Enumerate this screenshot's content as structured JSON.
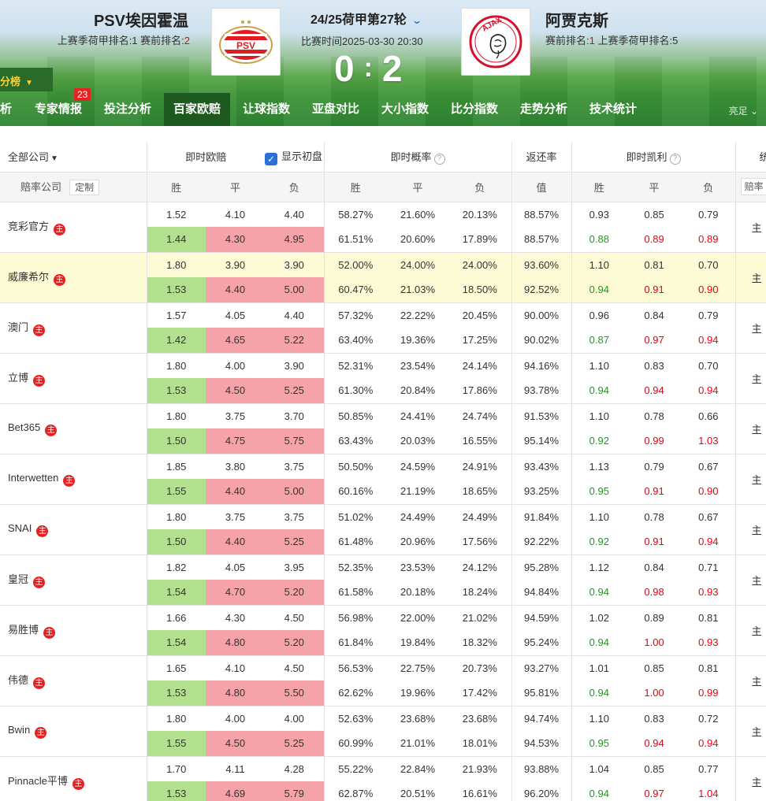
{
  "header": {
    "home": {
      "name": "PSV埃因霍温",
      "rank_text": "上赛季荷甲排名:1  赛前排名:",
      "rank_now": "2"
    },
    "away": {
      "name": "阿贾克斯",
      "rank_pre": "赛前排名:",
      "rank_now": "1",
      "rank_rest": "  上赛季荷甲排名:5"
    },
    "round": "24/25荷甲第27轮",
    "match_time": "比赛时间2025-03-30 20:30",
    "score_home": "0",
    "score_away": "2",
    "left_tab": "分榜"
  },
  "nav": {
    "items": [
      "析",
      "专家情报",
      "投注分析",
      "百家欧赔",
      "让球指数",
      "亚盘对比",
      "大小指数",
      "比分指数",
      "走势分析",
      "技术统计"
    ],
    "badge": "23",
    "theme": "亮足"
  },
  "table": {
    "all_companies": "全部公司",
    "live_euro": "即时欧赔",
    "show_initial": "显示初盘",
    "live_prob": "即时概率",
    "return_rate": "返还率",
    "live_kelly": "即时凯利",
    "extra": "统",
    "company_label": "赔率公司",
    "custom_btn": "定制",
    "win": "胜",
    "draw": "平",
    "loss": "负",
    "value": "值",
    "odds_btn": "赔率",
    "zhu": "主",
    "rows": [
      {
        "name": "竞彩官方",
        "a": [
          "1.52",
          "4.10",
          "4.40",
          "58.27%",
          "21.60%",
          "20.13%",
          "88.57%",
          "0.93",
          "0.85",
          "0.79"
        ],
        "b": [
          "1.44",
          "4.30",
          "4.95",
          "61.51%",
          "20.60%",
          "17.89%",
          "88.57%",
          "0.88",
          "0.89",
          "0.89"
        ],
        "kc": [
          "g",
          "r",
          "r"
        ]
      },
      {
        "name": "威廉希尔",
        "hl": true,
        "a": [
          "1.80",
          "3.90",
          "3.90",
          "52.00%",
          "24.00%",
          "24.00%",
          "93.60%",
          "1.10",
          "0.81",
          "0.70"
        ],
        "b": [
          "1.53",
          "4.40",
          "5.00",
          "60.47%",
          "21.03%",
          "18.50%",
          "92.52%",
          "0.94",
          "0.91",
          "0.90"
        ],
        "kc": [
          "g",
          "r",
          "r"
        ]
      },
      {
        "name": "澳门",
        "a": [
          "1.57",
          "4.05",
          "4.40",
          "57.32%",
          "22.22%",
          "20.45%",
          "90.00%",
          "0.96",
          "0.84",
          "0.79"
        ],
        "b": [
          "1.42",
          "4.65",
          "5.22",
          "63.40%",
          "19.36%",
          "17.25%",
          "90.02%",
          "0.87",
          "0.97",
          "0.94"
        ],
        "kc": [
          "g",
          "r",
          "r"
        ]
      },
      {
        "name": "立博",
        "a": [
          "1.80",
          "4.00",
          "3.90",
          "52.31%",
          "23.54%",
          "24.14%",
          "94.16%",
          "1.10",
          "0.83",
          "0.70"
        ],
        "b": [
          "1.53",
          "4.50",
          "5.25",
          "61.30%",
          "20.84%",
          "17.86%",
          "93.78%",
          "0.94",
          "0.94",
          "0.94"
        ],
        "kc": [
          "g",
          "r",
          "r"
        ]
      },
      {
        "name": "Bet365",
        "a": [
          "1.80",
          "3.75",
          "3.70",
          "50.85%",
          "24.41%",
          "24.74%",
          "91.53%",
          "1.10",
          "0.78",
          "0.66"
        ],
        "b": [
          "1.50",
          "4.75",
          "5.75",
          "63.43%",
          "20.03%",
          "16.55%",
          "95.14%",
          "0.92",
          "0.99",
          "1.03"
        ],
        "kc": [
          "g",
          "r",
          "r"
        ]
      },
      {
        "name": "Interwetten",
        "a": [
          "1.85",
          "3.80",
          "3.75",
          "50.50%",
          "24.59%",
          "24.91%",
          "93.43%",
          "1.13",
          "0.79",
          "0.67"
        ],
        "b": [
          "1.55",
          "4.40",
          "5.00",
          "60.16%",
          "21.19%",
          "18.65%",
          "93.25%",
          "0.95",
          "0.91",
          "0.90"
        ],
        "kc": [
          "g",
          "r",
          "r"
        ]
      },
      {
        "name": "SNAI",
        "a": [
          "1.80",
          "3.75",
          "3.75",
          "51.02%",
          "24.49%",
          "24.49%",
          "91.84%",
          "1.10",
          "0.78",
          "0.67"
        ],
        "b": [
          "1.50",
          "4.40",
          "5.25",
          "61.48%",
          "20.96%",
          "17.56%",
          "92.22%",
          "0.92",
          "0.91",
          "0.94"
        ],
        "kc": [
          "g",
          "r",
          "r"
        ]
      },
      {
        "name": "皇冠",
        "a": [
          "1.82",
          "4.05",
          "3.95",
          "52.35%",
          "23.53%",
          "24.12%",
          "95.28%",
          "1.12",
          "0.84",
          "0.71"
        ],
        "b": [
          "1.54",
          "4.70",
          "5.20",
          "61.58%",
          "20.18%",
          "18.24%",
          "94.84%",
          "0.94",
          "0.98",
          "0.93"
        ],
        "kc": [
          "g",
          "r",
          "r"
        ]
      },
      {
        "name": "易胜博",
        "a": [
          "1.66",
          "4.30",
          "4.50",
          "56.98%",
          "22.00%",
          "21.02%",
          "94.59%",
          "1.02",
          "0.89",
          "0.81"
        ],
        "b": [
          "1.54",
          "4.80",
          "5.20",
          "61.84%",
          "19.84%",
          "18.32%",
          "95.24%",
          "0.94",
          "1.00",
          "0.93"
        ],
        "kc": [
          "g",
          "r",
          "r"
        ]
      },
      {
        "name": "伟德",
        "a": [
          "1.65",
          "4.10",
          "4.50",
          "56.53%",
          "22.75%",
          "20.73%",
          "93.27%",
          "1.01",
          "0.85",
          "0.81"
        ],
        "b": [
          "1.53",
          "4.80",
          "5.50",
          "62.62%",
          "19.96%",
          "17.42%",
          "95.81%",
          "0.94",
          "1.00",
          "0.99"
        ],
        "kc": [
          "g",
          "r",
          "r"
        ]
      },
      {
        "name": "Bwin",
        "a": [
          "1.80",
          "4.00",
          "4.00",
          "52.63%",
          "23.68%",
          "23.68%",
          "94.74%",
          "1.10",
          "0.83",
          "0.72"
        ],
        "b": [
          "1.55",
          "4.50",
          "5.25",
          "60.99%",
          "21.01%",
          "18.01%",
          "94.53%",
          "0.95",
          "0.94",
          "0.94"
        ],
        "kc": [
          "g",
          "r",
          "r"
        ]
      },
      {
        "name": "Pinnacle平博",
        "a": [
          "1.70",
          "4.11",
          "4.28",
          "55.22%",
          "22.84%",
          "21.93%",
          "93.88%",
          "1.04",
          "0.85",
          "0.77"
        ],
        "b": [
          "1.53",
          "4.69",
          "5.79",
          "62.87%",
          "20.51%",
          "16.61%",
          "96.20%",
          "0.94",
          "0.97",
          "1.04"
        ],
        "kc": [
          "g",
          "r",
          "r"
        ]
      }
    ]
  }
}
